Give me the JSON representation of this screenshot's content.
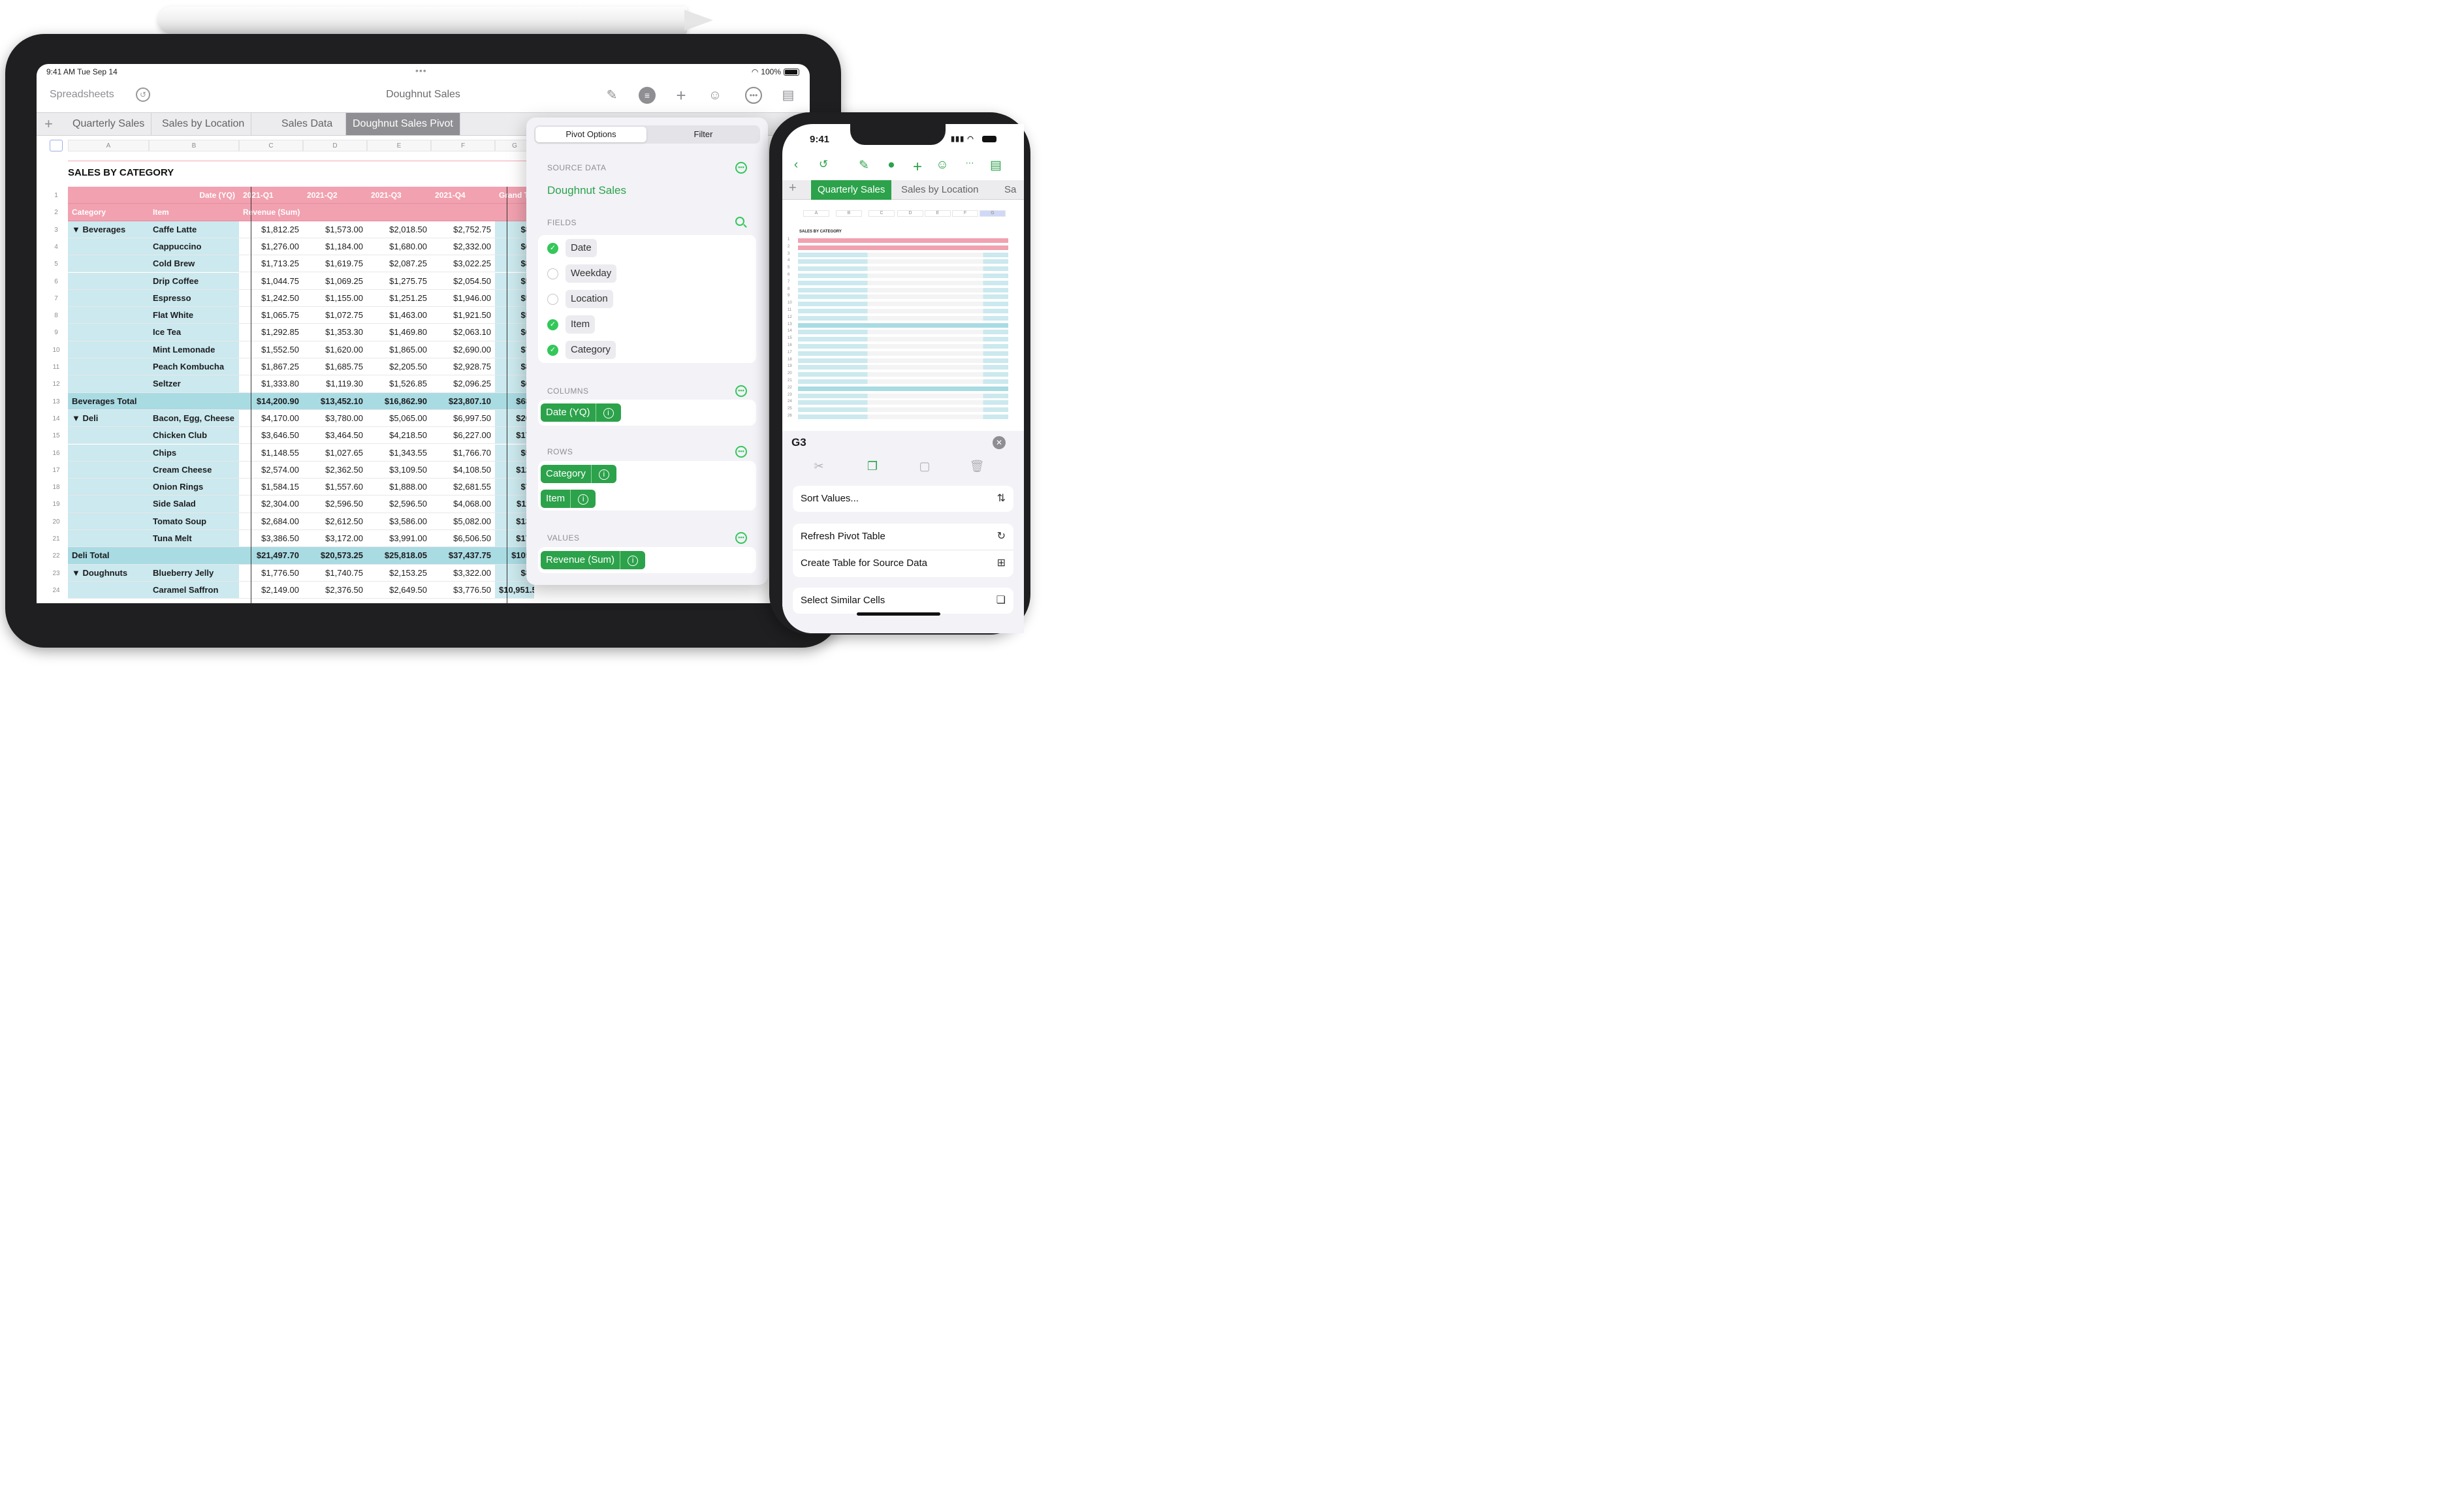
{
  "ipad": {
    "status": {
      "time": "9:41 AM  Tue Sep 14",
      "dots": "•••",
      "battery": "100%"
    },
    "toolbar": {
      "back": "Spreadsheets",
      "title": "Doughnut Sales"
    },
    "tabs": [
      "Quarterly Sales",
      "Sales by Location",
      "Sales Data",
      "Doughnut Sales Pivot"
    ],
    "columns": [
      "A",
      "B",
      "C",
      "D",
      "E",
      "F",
      "G"
    ],
    "sheet_title": "SALES BY CATEGORY",
    "header_row": {
      "label": "Date (YQ)",
      "periods": [
        "2021-Q1",
        "2021-Q2",
        "2021-Q3",
        "2021-Q4",
        "Grand T"
      ]
    },
    "subheader_row": {
      "category": "Category",
      "item": "Item",
      "measure": "Revenue (Sum)"
    },
    "rows": [
      {
        "n": "3",
        "cat": "▼  Beverages",
        "item": "Caffe Latte",
        "v": [
          "$1,812.25",
          "$1,573.00",
          "$2,018.50",
          "$2,752.75",
          "$8"
        ]
      },
      {
        "n": "4",
        "cat": "",
        "item": "Cappuccino",
        "v": [
          "$1,276.00",
          "$1,184.00",
          "$1,680.00",
          "$2,332.00",
          "$6"
        ]
      },
      {
        "n": "5",
        "cat": "",
        "item": "Cold Brew",
        "v": [
          "$1,713.25",
          "$1,619.75",
          "$2,087.25",
          "$3,022.25",
          "$8"
        ]
      },
      {
        "n": "6",
        "cat": "",
        "item": "Drip Coffee",
        "v": [
          "$1,044.75",
          "$1,069.25",
          "$1,275.75",
          "$2,054.50",
          "$5"
        ]
      },
      {
        "n": "7",
        "cat": "",
        "item": "Espresso",
        "v": [
          "$1,242.50",
          "$1,155.00",
          "$1,251.25",
          "$1,946.00",
          "$5"
        ]
      },
      {
        "n": "8",
        "cat": "",
        "item": "Flat White",
        "v": [
          "$1,065.75",
          "$1,072.75",
          "$1,463.00",
          "$1,921.50",
          "$5"
        ]
      },
      {
        "n": "9",
        "cat": "",
        "item": "Ice Tea",
        "v": [
          "$1,292.85",
          "$1,353.30",
          "$1,469.80",
          "$2,063.10",
          "$6"
        ]
      },
      {
        "n": "10",
        "cat": "",
        "item": "Mint Lemonade",
        "v": [
          "$1,552.50",
          "$1,620.00",
          "$1,865.00",
          "$2,690.00",
          "$7"
        ]
      },
      {
        "n": "11",
        "cat": "",
        "item": "Peach Kombucha",
        "v": [
          "$1,867.25",
          "$1,685.75",
          "$2,205.50",
          "$2,928.75",
          "$8"
        ]
      },
      {
        "n": "12",
        "cat": "",
        "item": "Seltzer",
        "v": [
          "$1,333.80",
          "$1,119.30",
          "$1,526.85",
          "$2,096.25",
          "$6"
        ]
      },
      {
        "n": "13",
        "total": "Beverages Total",
        "v": [
          "$14,200.90",
          "$13,452.10",
          "$16,862.90",
          "$23,807.10",
          "$68"
        ]
      },
      {
        "n": "14",
        "cat": "▼  Deli",
        "item": "Bacon, Egg, Cheese",
        "v": [
          "$4,170.00",
          "$3,780.00",
          "$5,065.00",
          "$6,997.50",
          "$20"
        ]
      },
      {
        "n": "15",
        "cat": "",
        "item": "Chicken Club",
        "v": [
          "$3,646.50",
          "$3,464.50",
          "$4,218.50",
          "$6,227.00",
          "$17"
        ]
      },
      {
        "n": "16",
        "cat": "",
        "item": "Chips",
        "v": [
          "$1,148.55",
          "$1,027.65",
          "$1,343.55",
          "$1,766.70",
          "$5"
        ]
      },
      {
        "n": "17",
        "cat": "",
        "item": "Cream Cheese",
        "v": [
          "$2,574.00",
          "$2,362.50",
          "$3,109.50",
          "$4,108.50",
          "$12"
        ]
      },
      {
        "n": "18",
        "cat": "",
        "item": "Onion Rings",
        "v": [
          "$1,584.15",
          "$1,557.60",
          "$1,888.00",
          "$2,681.55",
          "$7"
        ]
      },
      {
        "n": "19",
        "cat": "",
        "item": "Side Salad",
        "v": [
          "$2,304.00",
          "$2,596.50",
          "$2,596.50",
          "$4,068.00",
          "$11"
        ]
      },
      {
        "n": "20",
        "cat": "",
        "item": "Tomato Soup",
        "v": [
          "$2,684.00",
          "$2,612.50",
          "$3,586.00",
          "$5,082.00",
          "$13"
        ]
      },
      {
        "n": "21",
        "cat": "",
        "item": "Tuna Melt",
        "v": [
          "$3,386.50",
          "$3,172.00",
          "$3,991.00",
          "$6,506.50",
          "$17"
        ]
      },
      {
        "n": "22",
        "total": "Deli Total",
        "v": [
          "$21,497.70",
          "$20,573.25",
          "$25,818.05",
          "$37,437.75",
          "$105"
        ]
      },
      {
        "n": "23",
        "cat": "▼  Doughnuts",
        "item": "Blueberry Jelly",
        "v": [
          "$1,776.50",
          "$1,740.75",
          "$2,153.25",
          "$3,322.00",
          "$8"
        ]
      },
      {
        "n": "24",
        "cat": "",
        "item": "Caramel Saffron",
        "v": [
          "$2,149.00",
          "$2,376.50",
          "$2,649.50",
          "$3,776.50",
          "$10,951.50"
        ]
      }
    ]
  },
  "popover": {
    "segments": [
      "Pivot Options",
      "Filter"
    ],
    "source_label": "SOURCE DATA",
    "source_name": "Doughnut Sales",
    "fields_label": "FIELDS",
    "fields": [
      {
        "name": "Date",
        "checked": true
      },
      {
        "name": "Weekday",
        "checked": false
      },
      {
        "name": "Location",
        "checked": false
      },
      {
        "name": "Item",
        "checked": true
      },
      {
        "name": "Category",
        "checked": true
      }
    ],
    "columns_label": "COLUMNS",
    "columns": [
      "Date (YQ)"
    ],
    "rows_label": "ROWS",
    "rows": [
      "Category",
      "Item"
    ],
    "values_label": "VALUES",
    "values": [
      "Revenue (Sum)"
    ]
  },
  "iphone": {
    "time": "9:41",
    "tabs": [
      "Quarterly Sales",
      "Sales by Location",
      "Sa"
    ],
    "columns": [
      "A",
      "B",
      "C",
      "D",
      "E",
      "F",
      "G"
    ],
    "sheet_title": "SALES BY CATEGORY",
    "cell_ref": "G3",
    "menu": [
      "Sort Values...",
      "Refresh Pivot Table",
      "Create Table for Source Data",
      "Select Similar Cells"
    ],
    "accent": "#2ca24b"
  },
  "colors": {
    "header_pink": "#f1a1b0",
    "category_teal": "#cbe9ee",
    "total_teal": "#a9dbe3",
    "accent_green": "#2ca24b"
  }
}
